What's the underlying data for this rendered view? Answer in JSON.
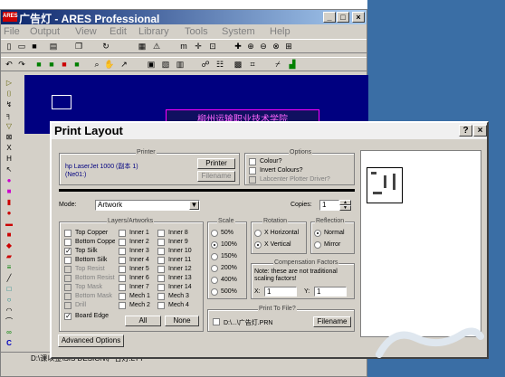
{
  "app": {
    "logo_text": "ARES",
    "title": "广告灯 - ARES Professional",
    "minimize_label": "_",
    "maximize_label": "□",
    "close_label": "×",
    "menu": [
      "File",
      "Output",
      "View",
      "Edit",
      "Library",
      "Tools",
      "System",
      "Help"
    ],
    "pcb_text": "柳州运输职业技术学院",
    "statusbar_path": "D:\\课以金\\SIS DESIGN\\广告灯.LYT",
    "status_c": "C"
  },
  "dialog": {
    "title": "Print Layout",
    "help_label": "?",
    "close_label": "×",
    "printer": {
      "group_label": "Printer",
      "name": "hp LaserJet 1000 (副本 1)",
      "port": "(Ne01:)",
      "printer_button": "Printer",
      "filename_button": "Filename"
    },
    "options": {
      "group_label": "Options",
      "colour": "Colour?",
      "invert": "Invert Colours?",
      "labcenter": "Labcenter Plotter Driver?"
    },
    "mode_label": "Mode:",
    "mode_value": "Artwork",
    "copies_label": "Copies:",
    "copies_value": "1",
    "layers": {
      "group_label": "Layers/Artworks",
      "col1": [
        "Top Copper",
        "Bottom Copper",
        "Top Silk",
        "Bottom Silk",
        "Top Resist",
        "Bottom Resist",
        "Top Mask",
        "Bottom Mask",
        "Drill",
        "Board Edge"
      ],
      "col2": [
        "Inner 1",
        "Inner 2",
        "Inner 3",
        "Inner 4",
        "Inner 5",
        "Inner 6",
        "Inner 7",
        "Mech 1",
        "Mech 2"
      ],
      "col3": [
        "Inner 8",
        "Inner 9",
        "Inner 10",
        "Inner 11",
        "Inner 12",
        "Inner 13",
        "Inner 14",
        "Mech 3",
        "Mech 4"
      ],
      "all_button": "All",
      "none_button": "None"
    },
    "scale": {
      "group_label": "Scale",
      "options": [
        "50%",
        "100%",
        "150%",
        "200%",
        "400%",
        "500%"
      ],
      "selected": "100%"
    },
    "rotation": {
      "group_label": "Rotation",
      "options": [
        "X Horizontal",
        "X Vertical"
      ],
      "selected": "X Vertical"
    },
    "reflection": {
      "group_label": "Reflection",
      "options": [
        "Normal",
        "Mirror"
      ],
      "selected": "Normal"
    },
    "compensation": {
      "group_label": "Compensation Factors",
      "note": "Note: these are not traditional scaling factors!",
      "x_label": "X:",
      "x_value": "1",
      "y_label": "Y:",
      "y_value": "1"
    },
    "print_to_file": {
      "group_label": "Print To File?",
      "path": "D:\\...\\广告灯.PRN",
      "filename_button": "Filename"
    },
    "advanced_button": "Advanced Options"
  }
}
